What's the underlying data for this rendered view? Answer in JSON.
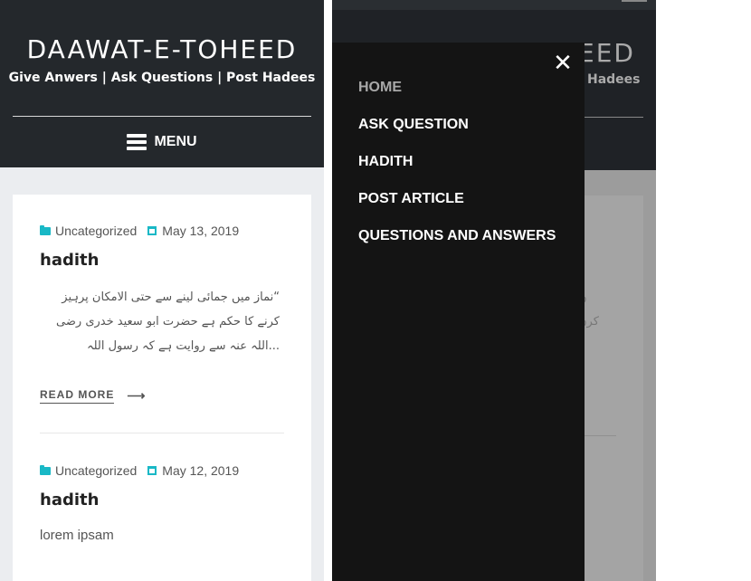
{
  "site": {
    "title": "DAAWAT-E-TOHEED",
    "tagline": "Give Anwers | Ask Questions | Post Hadees",
    "menu_label": "MENU"
  },
  "posts": [
    {
      "category": "Uncategorized",
      "date": "May 13, 2019",
      "title": "hadith",
      "excerpt_lines": [
        "“نماز میں جمائی لینے سے حتی الامکان پرہیز",
        "کرنے کا حکم ہے حضرت ابو سعید خدری رضی",
        "...اللہ عنہ سے روایت ہے کہ رسول اللہ"
      ],
      "read_more": "READ MORE"
    },
    {
      "category": "Uncategorized",
      "date": "May 12, 2019",
      "title": "hadith",
      "excerpt": "lorem ipsam"
    }
  ],
  "background_fragments": {
    "title_tail": "EED",
    "tagline_tail": "Hadees",
    "urdu_tail_1": "ن",
    "urdu_tail_2": "کرن"
  },
  "drawer": {
    "close_glyph": "✕",
    "items": [
      {
        "label": "HOME",
        "current": true
      },
      {
        "label": "ASK QUESTION",
        "current": false
      },
      {
        "label": "HADITH",
        "current": false
      },
      {
        "label": "POST ARTICLE",
        "current": false
      },
      {
        "label": "QUESTIONS AND ANSWERS",
        "current": false
      }
    ]
  },
  "colors": {
    "header_bg": "#24282c",
    "accent": "#19b8c6",
    "drawer_bg": "#141414",
    "page_bg": "#ebedf0"
  }
}
